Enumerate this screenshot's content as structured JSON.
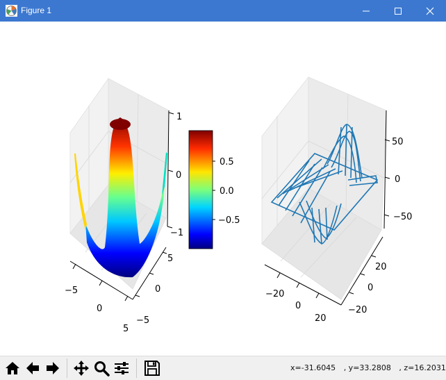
{
  "window": {
    "title": "Figure 1"
  },
  "figure": {
    "left_axes": {
      "x_ticks": [
        "−5",
        "0",
        "5"
      ],
      "y_ticks": [
        "−5",
        "0",
        "5"
      ],
      "z_ticks": [
        "−1",
        "0",
        "1"
      ]
    },
    "colorbar": {
      "ticks": [
        "0.5",
        "0.0",
        "−0.5"
      ],
      "colormap": "jet"
    },
    "right_axes": {
      "x_ticks": [
        "−20",
        "0",
        "20"
      ],
      "y_ticks": [
        "−20",
        "0",
        "20"
      ],
      "z_ticks": [
        "50",
        "0",
        "−50"
      ],
      "wire_color": "#1f77b4"
    }
  },
  "toolbar": {
    "buttons": [
      "home-icon",
      "back-arrow-icon",
      "forward-arrow-icon",
      "pan-icon",
      "zoom-icon",
      "configure-subplots-icon",
      "save-icon"
    ]
  },
  "status": {
    "x": "x=-31.6045",
    "y": ", y=33.2808",
    "z": ", z=16.2031"
  }
}
